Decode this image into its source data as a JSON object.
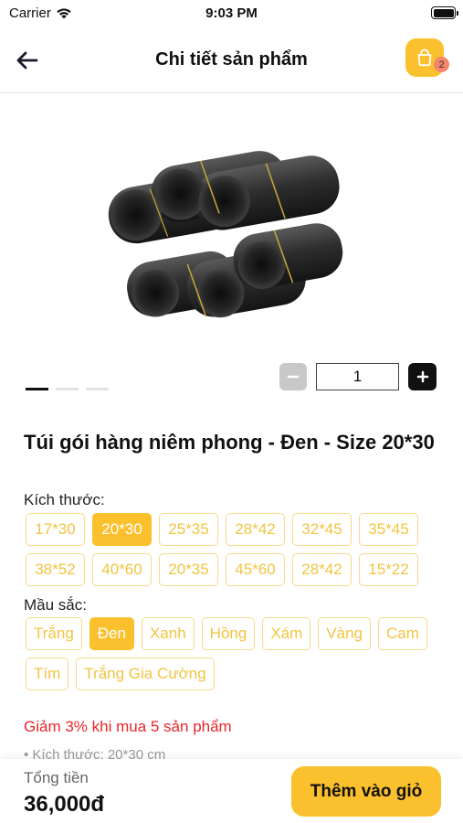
{
  "status_bar": {
    "carrier": "Carrier",
    "time": "9:03 PM"
  },
  "nav": {
    "title": "Chi tiết sản phẩm",
    "cart_count": "2"
  },
  "gallery": {
    "image_count": 3,
    "active_index": 0
  },
  "quantity": {
    "value": "1"
  },
  "product": {
    "title": "Túi gói hàng niêm phong - Đen - Size 20*30"
  },
  "size": {
    "label": "Kích thước:",
    "options": [
      "17*30",
      "20*30",
      "25*35",
      "28*42",
      "32*45",
      "35*45",
      "38*52",
      "40*60",
      "20*35",
      "45*60",
      "28*42",
      "15*22"
    ],
    "selected": "20*30"
  },
  "color": {
    "label": "Mầu sắc:",
    "options": [
      "Trắng",
      "Đen",
      "Xanh",
      "Hồng",
      "Xám",
      "Vàng",
      "Cam",
      "Tím",
      "Trắng Gia Cường"
    ],
    "selected": "Đen"
  },
  "promo": "Giảm 3% khi mua 5 sản phẩm",
  "spec_line": "• Kích thước: 20*30 cm",
  "bottom": {
    "total_label": "Tổng tiền",
    "total_value": "36,000đ",
    "add_button": "Thêm vào giỏ"
  },
  "colors": {
    "accent": "#fbc02d",
    "promo": "#e8262a",
    "chip_border": "#f7d98a",
    "chip_text": "#f1c440"
  }
}
